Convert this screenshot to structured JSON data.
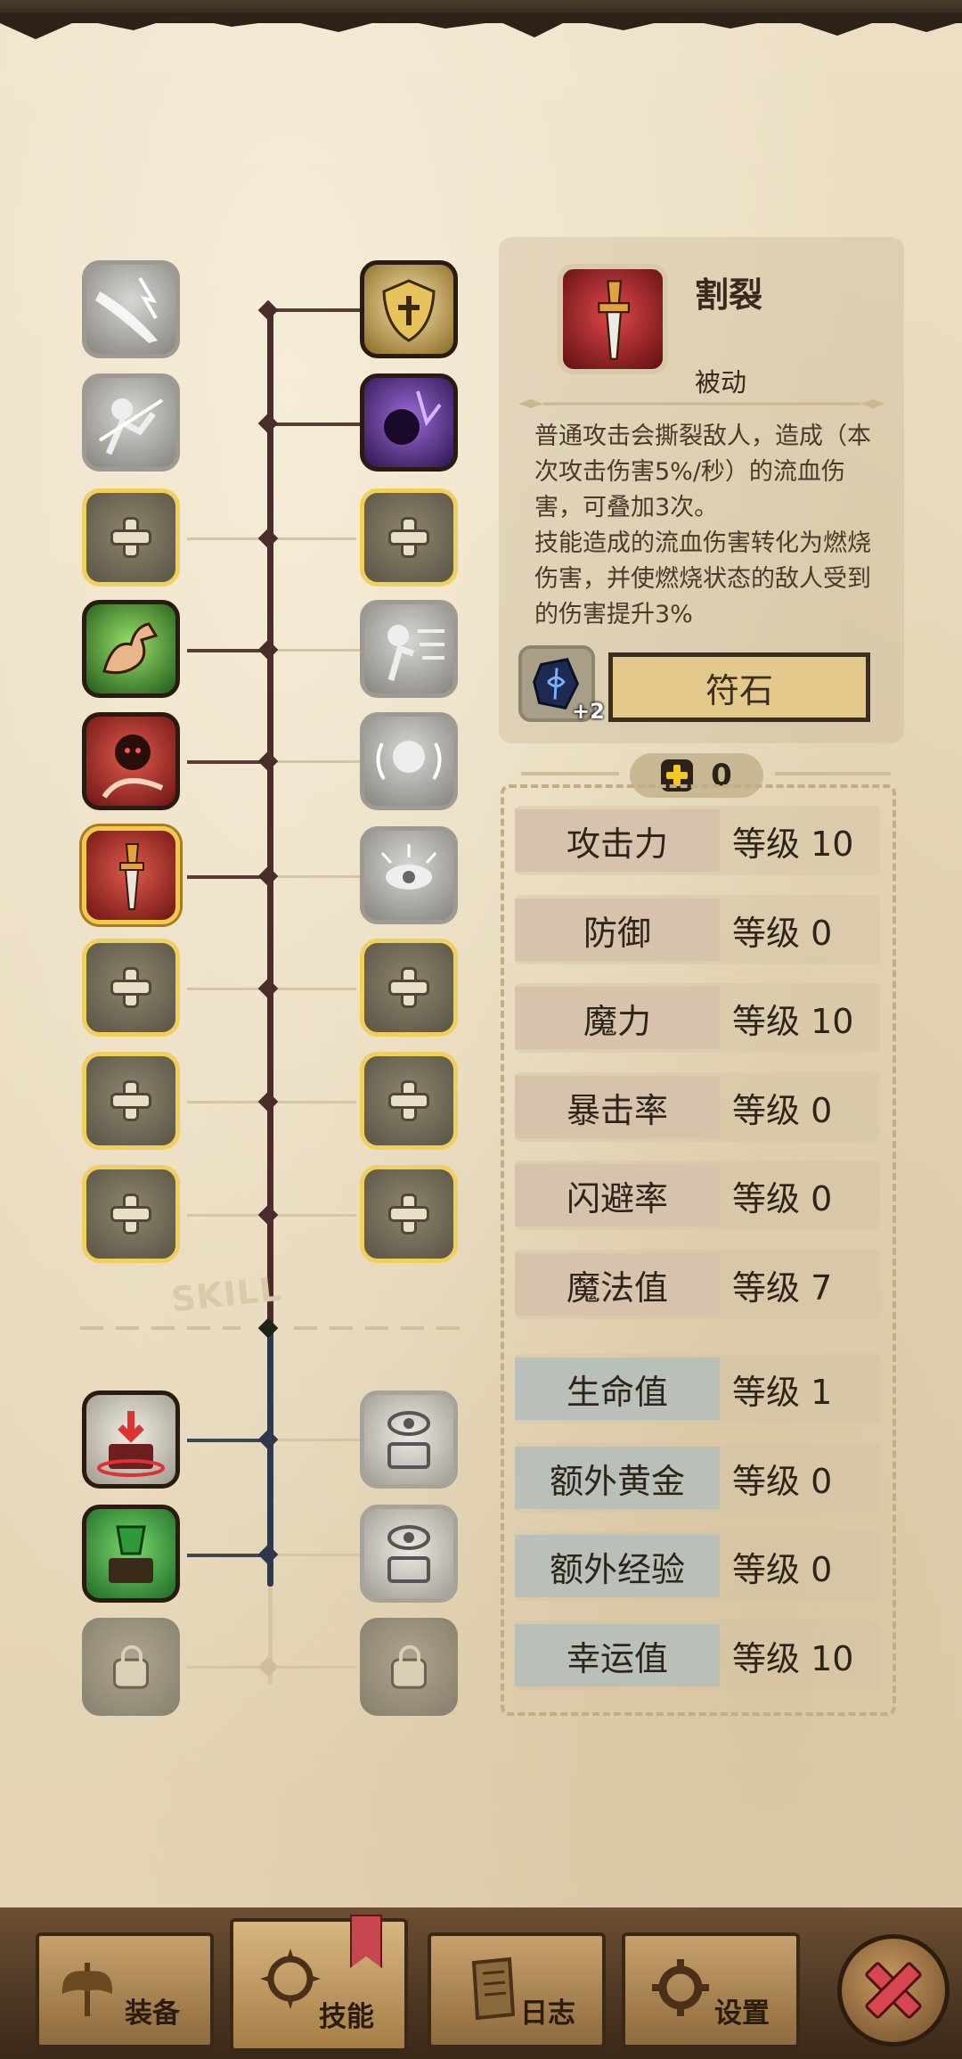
{
  "skill_detail": {
    "name": "割裂",
    "type": "被动",
    "description": "普通攻击会撕裂敌人，造成（本次攻击伤害5%/秒）的流血伤害，可叠加3次。\n技能造成的流血伤害转化为燃烧伤害，并使燃烧状态的敌人受到的伤害提升3%",
    "rune_count": "+2",
    "rune_button": "符石"
  },
  "skill_points": "0",
  "tree_label": "SKILL",
  "stats": [
    {
      "name": "攻击力",
      "value": "等级 10"
    },
    {
      "name": "防御",
      "value": "等级 0"
    },
    {
      "name": "魔力",
      "value": "等级 10"
    },
    {
      "name": "暴击率",
      "value": "等级 0"
    },
    {
      "name": "闪避率",
      "value": "等级 0"
    },
    {
      "name": "魔法值",
      "value": "等级 7"
    },
    {
      "name": "生命值",
      "value": "等级 1"
    },
    {
      "name": "额外黄金",
      "value": "等级 0"
    },
    {
      "name": "额外经验",
      "value": "等级 0"
    },
    {
      "name": "幸运值",
      "value": "等级 10"
    }
  ],
  "tabs": [
    {
      "label": "装备",
      "icon": "axe-icon"
    },
    {
      "label": "技能",
      "icon": "skill-icon"
    },
    {
      "label": "日志",
      "icon": "journal-icon"
    },
    {
      "label": "设置",
      "icon": "gear-icon"
    }
  ],
  "colors": {
    "accent_gold": "#f2c94c",
    "close_red": "#d64550",
    "parchment": "#e9dcc0"
  }
}
